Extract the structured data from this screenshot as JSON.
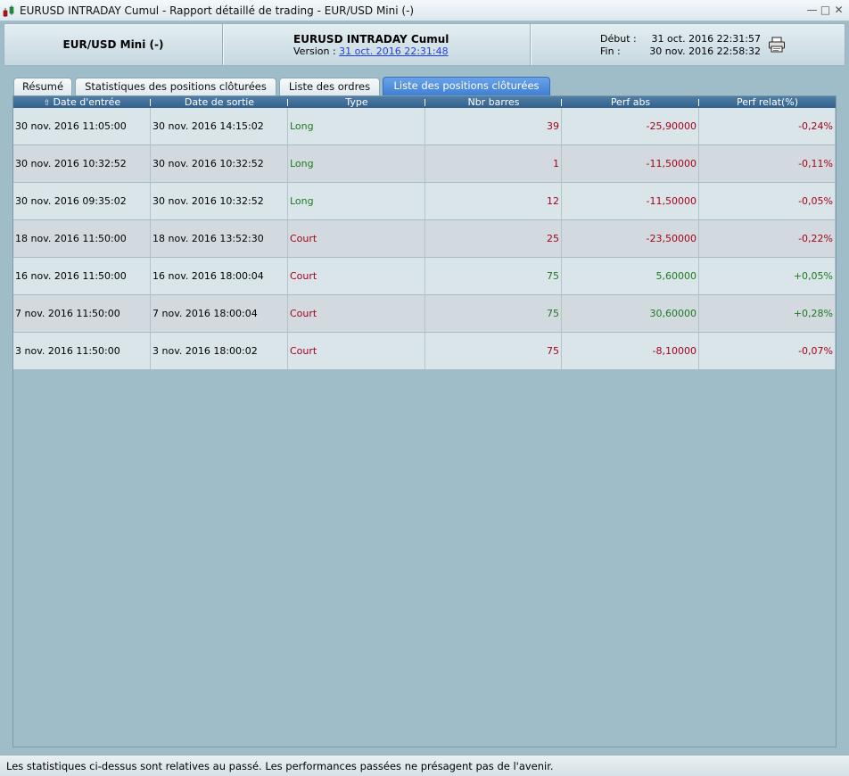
{
  "window": {
    "title": "EURUSD INTRADAY Cumul - Rapport détaillé de trading - EUR/USD Mini (-)",
    "icon": "candlestick-chart-icon",
    "min_symbol": "—",
    "max_symbol": "□",
    "close_symbol": "✕"
  },
  "header": {
    "instrument": "EUR/USD Mini (-)",
    "strategy_name": "EURUSD INTRADAY Cumul",
    "version_label": "Version :",
    "version_value": "31 oct. 2016 22:31:48",
    "start_label": "Début :",
    "start_value": "31 oct. 2016 22:31:57",
    "end_label": "Fin :",
    "end_value": "30 nov. 2016 22:58:32",
    "print_icon": "printer-icon"
  },
  "tabs": [
    {
      "label": "Résumé",
      "active": false
    },
    {
      "label": "Statistiques des positions clôturées",
      "active": false
    },
    {
      "label": "Liste des ordres",
      "active": false
    },
    {
      "label": "Liste des positions clôturées",
      "active": true
    }
  ],
  "table": {
    "columns": [
      "Date d'entrée",
      "Date de sortie",
      "Type",
      "Nbr barres",
      "Perf abs",
      "Perf relat(%)"
    ],
    "sort_icon": "sort-up-arrow-icon",
    "rows": [
      {
        "entry": "30 nov. 2016 11:05:00",
        "exit": "30 nov. 2016 14:15:02",
        "type": "Long",
        "bars": "39",
        "perf_abs": "-25,90000",
        "perf_rel": "-0,24%"
      },
      {
        "entry": "30 nov. 2016 10:32:52",
        "exit": "30 nov. 2016 10:32:52",
        "type": "Long",
        "bars": "1",
        "perf_abs": "-11,50000",
        "perf_rel": "-0,11%"
      },
      {
        "entry": "30 nov. 2016 09:35:02",
        "exit": "30 nov. 2016 10:32:52",
        "type": "Long",
        "bars": "12",
        "perf_abs": "-11,50000",
        "perf_rel": "-0,05%"
      },
      {
        "entry": "18 nov. 2016 11:50:00",
        "exit": "18 nov. 2016 13:52:30",
        "type": "Court",
        "bars": "25",
        "perf_abs": "-23,50000",
        "perf_rel": "-0,22%"
      },
      {
        "entry": "16 nov. 2016 11:50:00",
        "exit": "16 nov. 2016 18:00:04",
        "type": "Court",
        "bars": "75",
        "perf_abs": "5,60000",
        "perf_rel": "+0,05%"
      },
      {
        "entry": "7 nov. 2016 11:50:00",
        "exit": "7 nov. 2016 18:00:04",
        "type": "Court",
        "bars": "75",
        "perf_abs": "30,60000",
        "perf_rel": "+0,28%"
      },
      {
        "entry": "3 nov. 2016 11:50:00",
        "exit": "3 nov. 2016 18:00:02",
        "type": "Court",
        "bars": "75",
        "perf_abs": "-8,10000",
        "perf_rel": "-0,07%"
      }
    ]
  },
  "colors": {
    "long": "#1e7a1e",
    "short": "#a8001a",
    "positive": "#1e7a1e",
    "negative": "#a8001a",
    "header_bar": "#3e6c96",
    "active_tab": "#4f8ede"
  },
  "status": {
    "text": "Les statistiques ci-dessus sont relatives au passé. Les performances passées ne présagent pas de l'avenir."
  }
}
